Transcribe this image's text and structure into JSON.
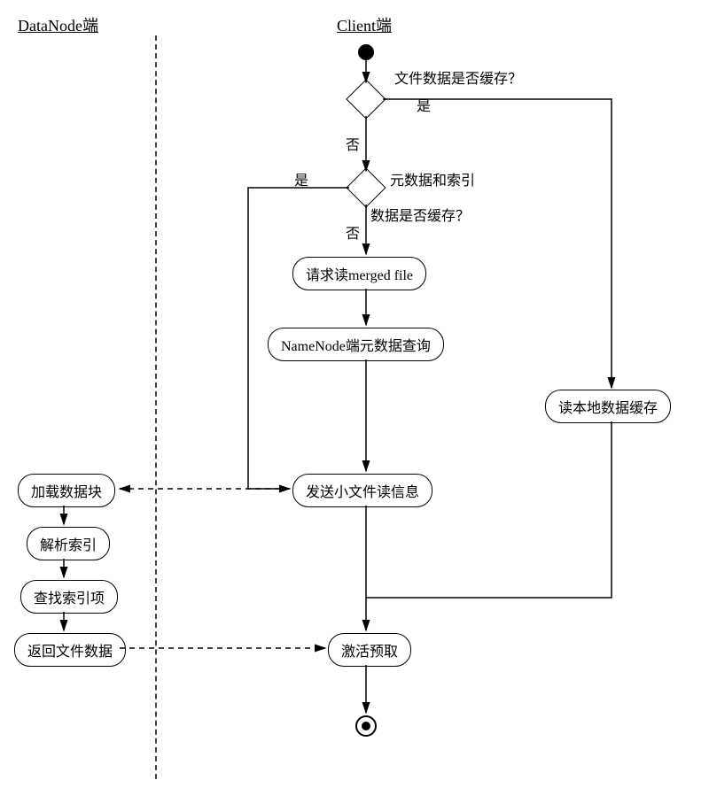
{
  "lanes": {
    "datanode": "DataNode端",
    "client": "Client端"
  },
  "decisions": {
    "d1": {
      "question": "文件数据是否缓存？",
      "yes": "是",
      "no": "否"
    },
    "d2": {
      "question": "元数据和索引\n数据是否缓存？",
      "q_line1": "元数据和索引",
      "q_line2": "数据是否缓存？",
      "yes": "是",
      "no": "否"
    }
  },
  "nodes": {
    "request_read": "请求读merged file",
    "namenode_query": "NameNode端元数据查询",
    "read_local_cache": "读本地数据缓存",
    "send_small_file": "发送小文件读信息",
    "load_block": "加载数据块",
    "parse_index": "解析索引",
    "lookup_index": "查找索引项",
    "return_file": "返回文件数据",
    "activate_prefetch": "激活预取"
  }
}
